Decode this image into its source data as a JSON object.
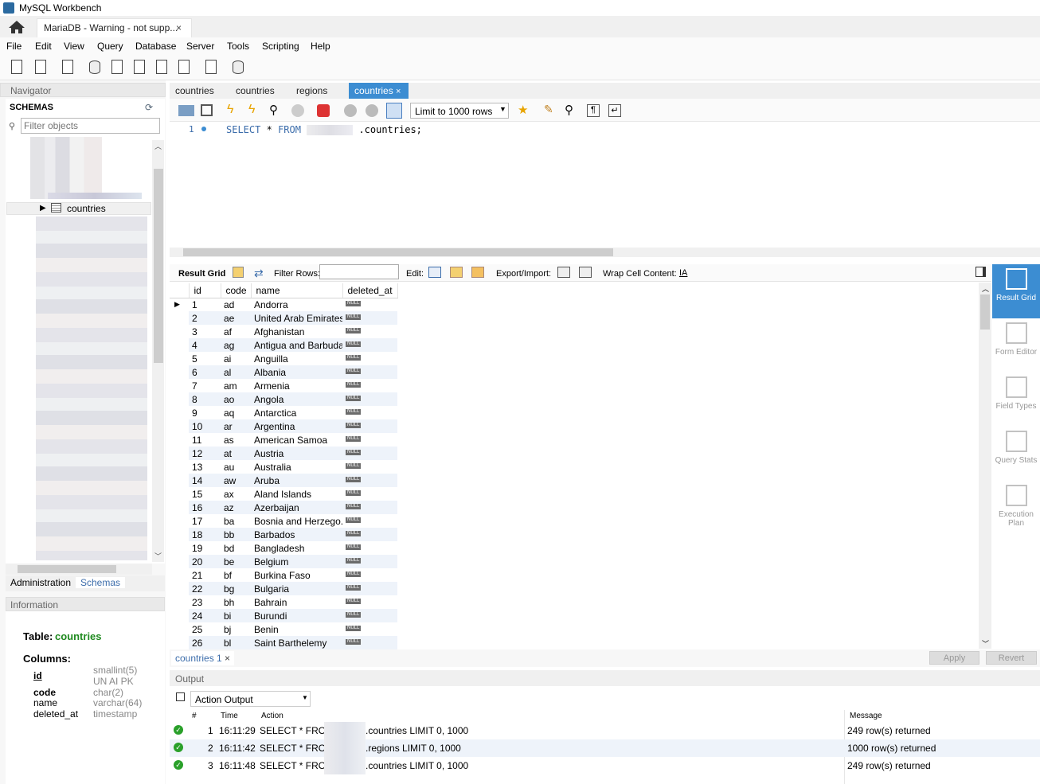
{
  "window": {
    "title": "MySQL Workbench"
  },
  "connection_tab": {
    "label": "MariaDB - Warning - not supp...",
    "close": "×"
  },
  "menu": [
    "File",
    "Edit",
    "View",
    "Query",
    "Database",
    "Server",
    "Tools",
    "Scripting",
    "Help"
  ],
  "navigator": {
    "header": "Navigator",
    "schemas_title": "SCHEMAS",
    "filter_placeholder": "Filter objects",
    "selected_table": "countries",
    "tabs": [
      "Administration",
      "Schemas"
    ]
  },
  "information": {
    "header": "Information",
    "table_label": "Table:",
    "table_name": "countries",
    "columns_label": "Columns:",
    "columns": [
      {
        "name": "id",
        "type": "smallint(5)",
        "extra": "UN AI PK"
      },
      {
        "name": "code",
        "type": "char(2)",
        "extra": ""
      },
      {
        "name": "name",
        "type": "varchar(64)",
        "extra": ""
      },
      {
        "name": "deleted_at",
        "type": "timestamp",
        "extra": ""
      }
    ]
  },
  "query_tabs": [
    "countries",
    "countries",
    "regions",
    "countries"
  ],
  "query_tab_close": "×",
  "limit_select": "Limit to 1000 rows",
  "editor": {
    "line_number": "1",
    "kw_select": "SELECT",
    "star": "*",
    "kw_from": "FROM",
    "rest": ".countries;"
  },
  "result_toolbar": {
    "result_grid": "Result Grid",
    "filter_rows": "Filter Rows:",
    "edit": "Edit:",
    "export_import": "Export/Import:",
    "wrap": "Wrap Cell Content:"
  },
  "grid": {
    "columns": [
      "id",
      "code",
      "name",
      "deleted_at"
    ],
    "null_text": "NULL",
    "rows": [
      [
        "1",
        "ad",
        "Andorra"
      ],
      [
        "2",
        "ae",
        "United Arab Emirates"
      ],
      [
        "3",
        "af",
        "Afghanistan"
      ],
      [
        "4",
        "ag",
        "Antigua and Barbuda"
      ],
      [
        "5",
        "ai",
        "Anguilla"
      ],
      [
        "6",
        "al",
        "Albania"
      ],
      [
        "7",
        "am",
        "Armenia"
      ],
      [
        "8",
        "ao",
        "Angola"
      ],
      [
        "9",
        "aq",
        "Antarctica"
      ],
      [
        "10",
        "ar",
        "Argentina"
      ],
      [
        "11",
        "as",
        "American Samoa"
      ],
      [
        "12",
        "at",
        "Austria"
      ],
      [
        "13",
        "au",
        "Australia"
      ],
      [
        "14",
        "aw",
        "Aruba"
      ],
      [
        "15",
        "ax",
        "Aland Islands"
      ],
      [
        "16",
        "az",
        "Azerbaijan"
      ],
      [
        "17",
        "ba",
        "Bosnia and Herzego..."
      ],
      [
        "18",
        "bb",
        "Barbados"
      ],
      [
        "19",
        "bd",
        "Bangladesh"
      ],
      [
        "20",
        "be",
        "Belgium"
      ],
      [
        "21",
        "bf",
        "Burkina Faso"
      ],
      [
        "22",
        "bg",
        "Bulgaria"
      ],
      [
        "23",
        "bh",
        "Bahrain"
      ],
      [
        "24",
        "bi",
        "Burundi"
      ],
      [
        "25",
        "bj",
        "Benin"
      ],
      [
        "26",
        "bl",
        "Saint Barthelemy"
      ]
    ]
  },
  "side_panel": [
    {
      "label": "Result Grid"
    },
    {
      "label": "Form Editor"
    },
    {
      "label": "Field Types"
    },
    {
      "label": "Query Stats"
    },
    {
      "label": "Execution Plan"
    }
  ],
  "result_tab": {
    "label": "countries 1",
    "close": "×"
  },
  "buttons": {
    "apply": "Apply",
    "revert": "Revert"
  },
  "output": {
    "header": "Output",
    "select": "Action Output",
    "columns": [
      "#",
      "Time",
      "Action",
      "Message"
    ],
    "rows": [
      {
        "n": "1",
        "time": "16:11:29",
        "action_a": "SELECT * FROM",
        "action_b": ".countries LIMIT 0, 1000",
        "message": "249 row(s) returned"
      },
      {
        "n": "2",
        "time": "16:11:42",
        "action_a": "SELECT * FROM",
        "action_b": ".regions LIMIT 0, 1000",
        "message": "1000 row(s) returned"
      },
      {
        "n": "3",
        "time": "16:11:48",
        "action_a": "SELECT * FROM",
        "action_b": ".countries LIMIT 0, 1000",
        "message": "249 row(s) returned"
      }
    ]
  }
}
